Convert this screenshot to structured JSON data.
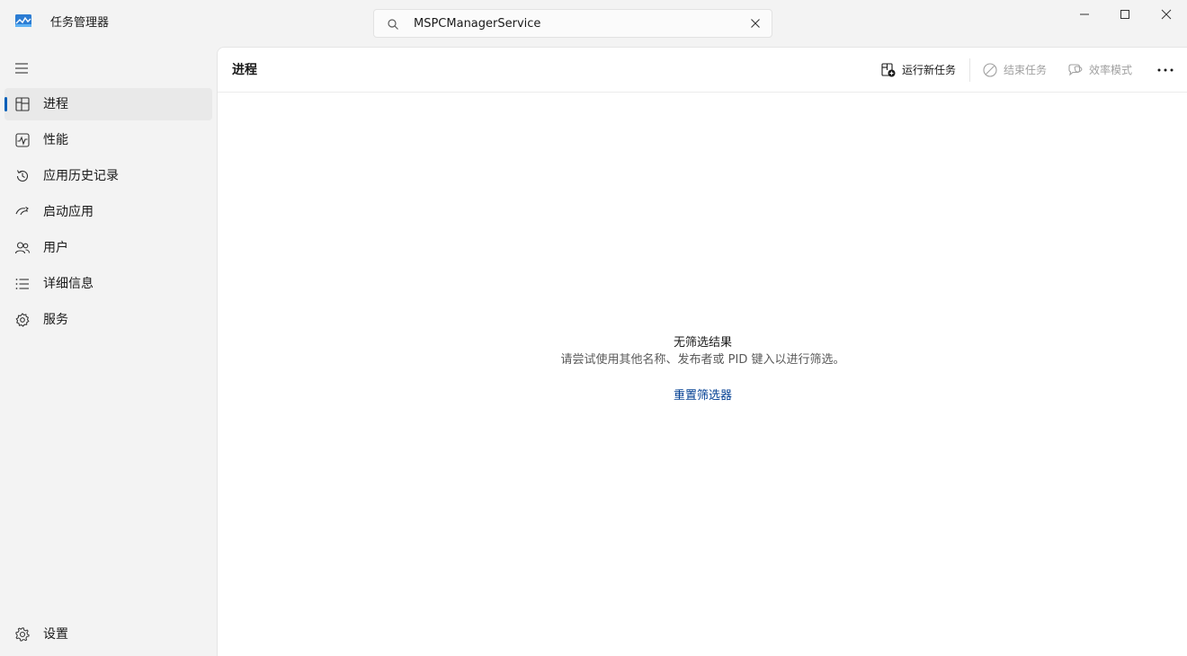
{
  "app": {
    "title": "任务管理器"
  },
  "search": {
    "value": "MSPCManagerService",
    "placeholder": ""
  },
  "window_controls": {
    "minimize": "minimize-icon",
    "maximize": "maximize-icon",
    "close": "close-icon"
  },
  "sidebar": {
    "items": [
      {
        "label": "进程",
        "icon": "processes-icon",
        "active": true
      },
      {
        "label": "性能",
        "icon": "performance-icon",
        "active": false
      },
      {
        "label": "应用历史记录",
        "icon": "history-icon",
        "active": false
      },
      {
        "label": "启动应用",
        "icon": "startup-icon",
        "active": false
      },
      {
        "label": "用户",
        "icon": "users-icon",
        "active": false
      },
      {
        "label": "详细信息",
        "icon": "details-icon",
        "active": false
      },
      {
        "label": "服务",
        "icon": "services-icon",
        "active": false
      }
    ],
    "settings_label": "设置"
  },
  "main": {
    "page_title": "进程",
    "toolbar": {
      "run_new_task": "运行新任务",
      "end_task": "结束任务",
      "efficiency_mode": "效率模式"
    },
    "empty_state": {
      "title": "无筛选结果",
      "description": "请尝试使用其他名称、发布者或 PID 键入以进行筛选。",
      "reset_link": "重置筛选器"
    }
  },
  "colors": {
    "accent": "#005fb8",
    "link": "#003e92",
    "disabled_text": "#a0a0a0",
    "sidebar_bg": "#f3f3f3",
    "content_bg": "#ffffff"
  }
}
